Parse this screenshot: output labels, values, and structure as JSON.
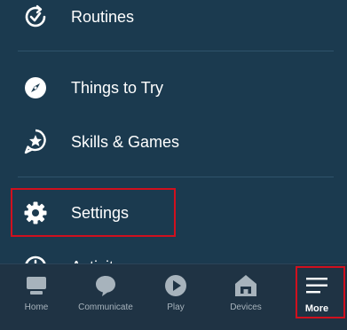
{
  "menu": {
    "items": [
      {
        "label": "Routines",
        "icon": "routines-icon"
      },
      {
        "label": "Things to Try",
        "icon": "compass-icon"
      },
      {
        "label": "Skills & Games",
        "icon": "skills-icon"
      },
      {
        "label": "Settings",
        "icon": "gear-icon"
      },
      {
        "label": "Activity",
        "icon": "activity-icon"
      }
    ]
  },
  "tabbar": {
    "tabs": [
      {
        "label": "Home",
        "icon": "home-icon"
      },
      {
        "label": "Communicate",
        "icon": "chat-bubble-icon"
      },
      {
        "label": "Play",
        "icon": "play-icon"
      },
      {
        "label": "Devices",
        "icon": "devices-icon"
      },
      {
        "label": "More",
        "icon": "hamburger-menu-icon",
        "active": true
      }
    ]
  },
  "colors": {
    "background": "#1b3a4f",
    "tabbar": "#1f3344",
    "highlight": "#d0101e",
    "text": "#ffffff",
    "muted": "#a7b3bc"
  }
}
